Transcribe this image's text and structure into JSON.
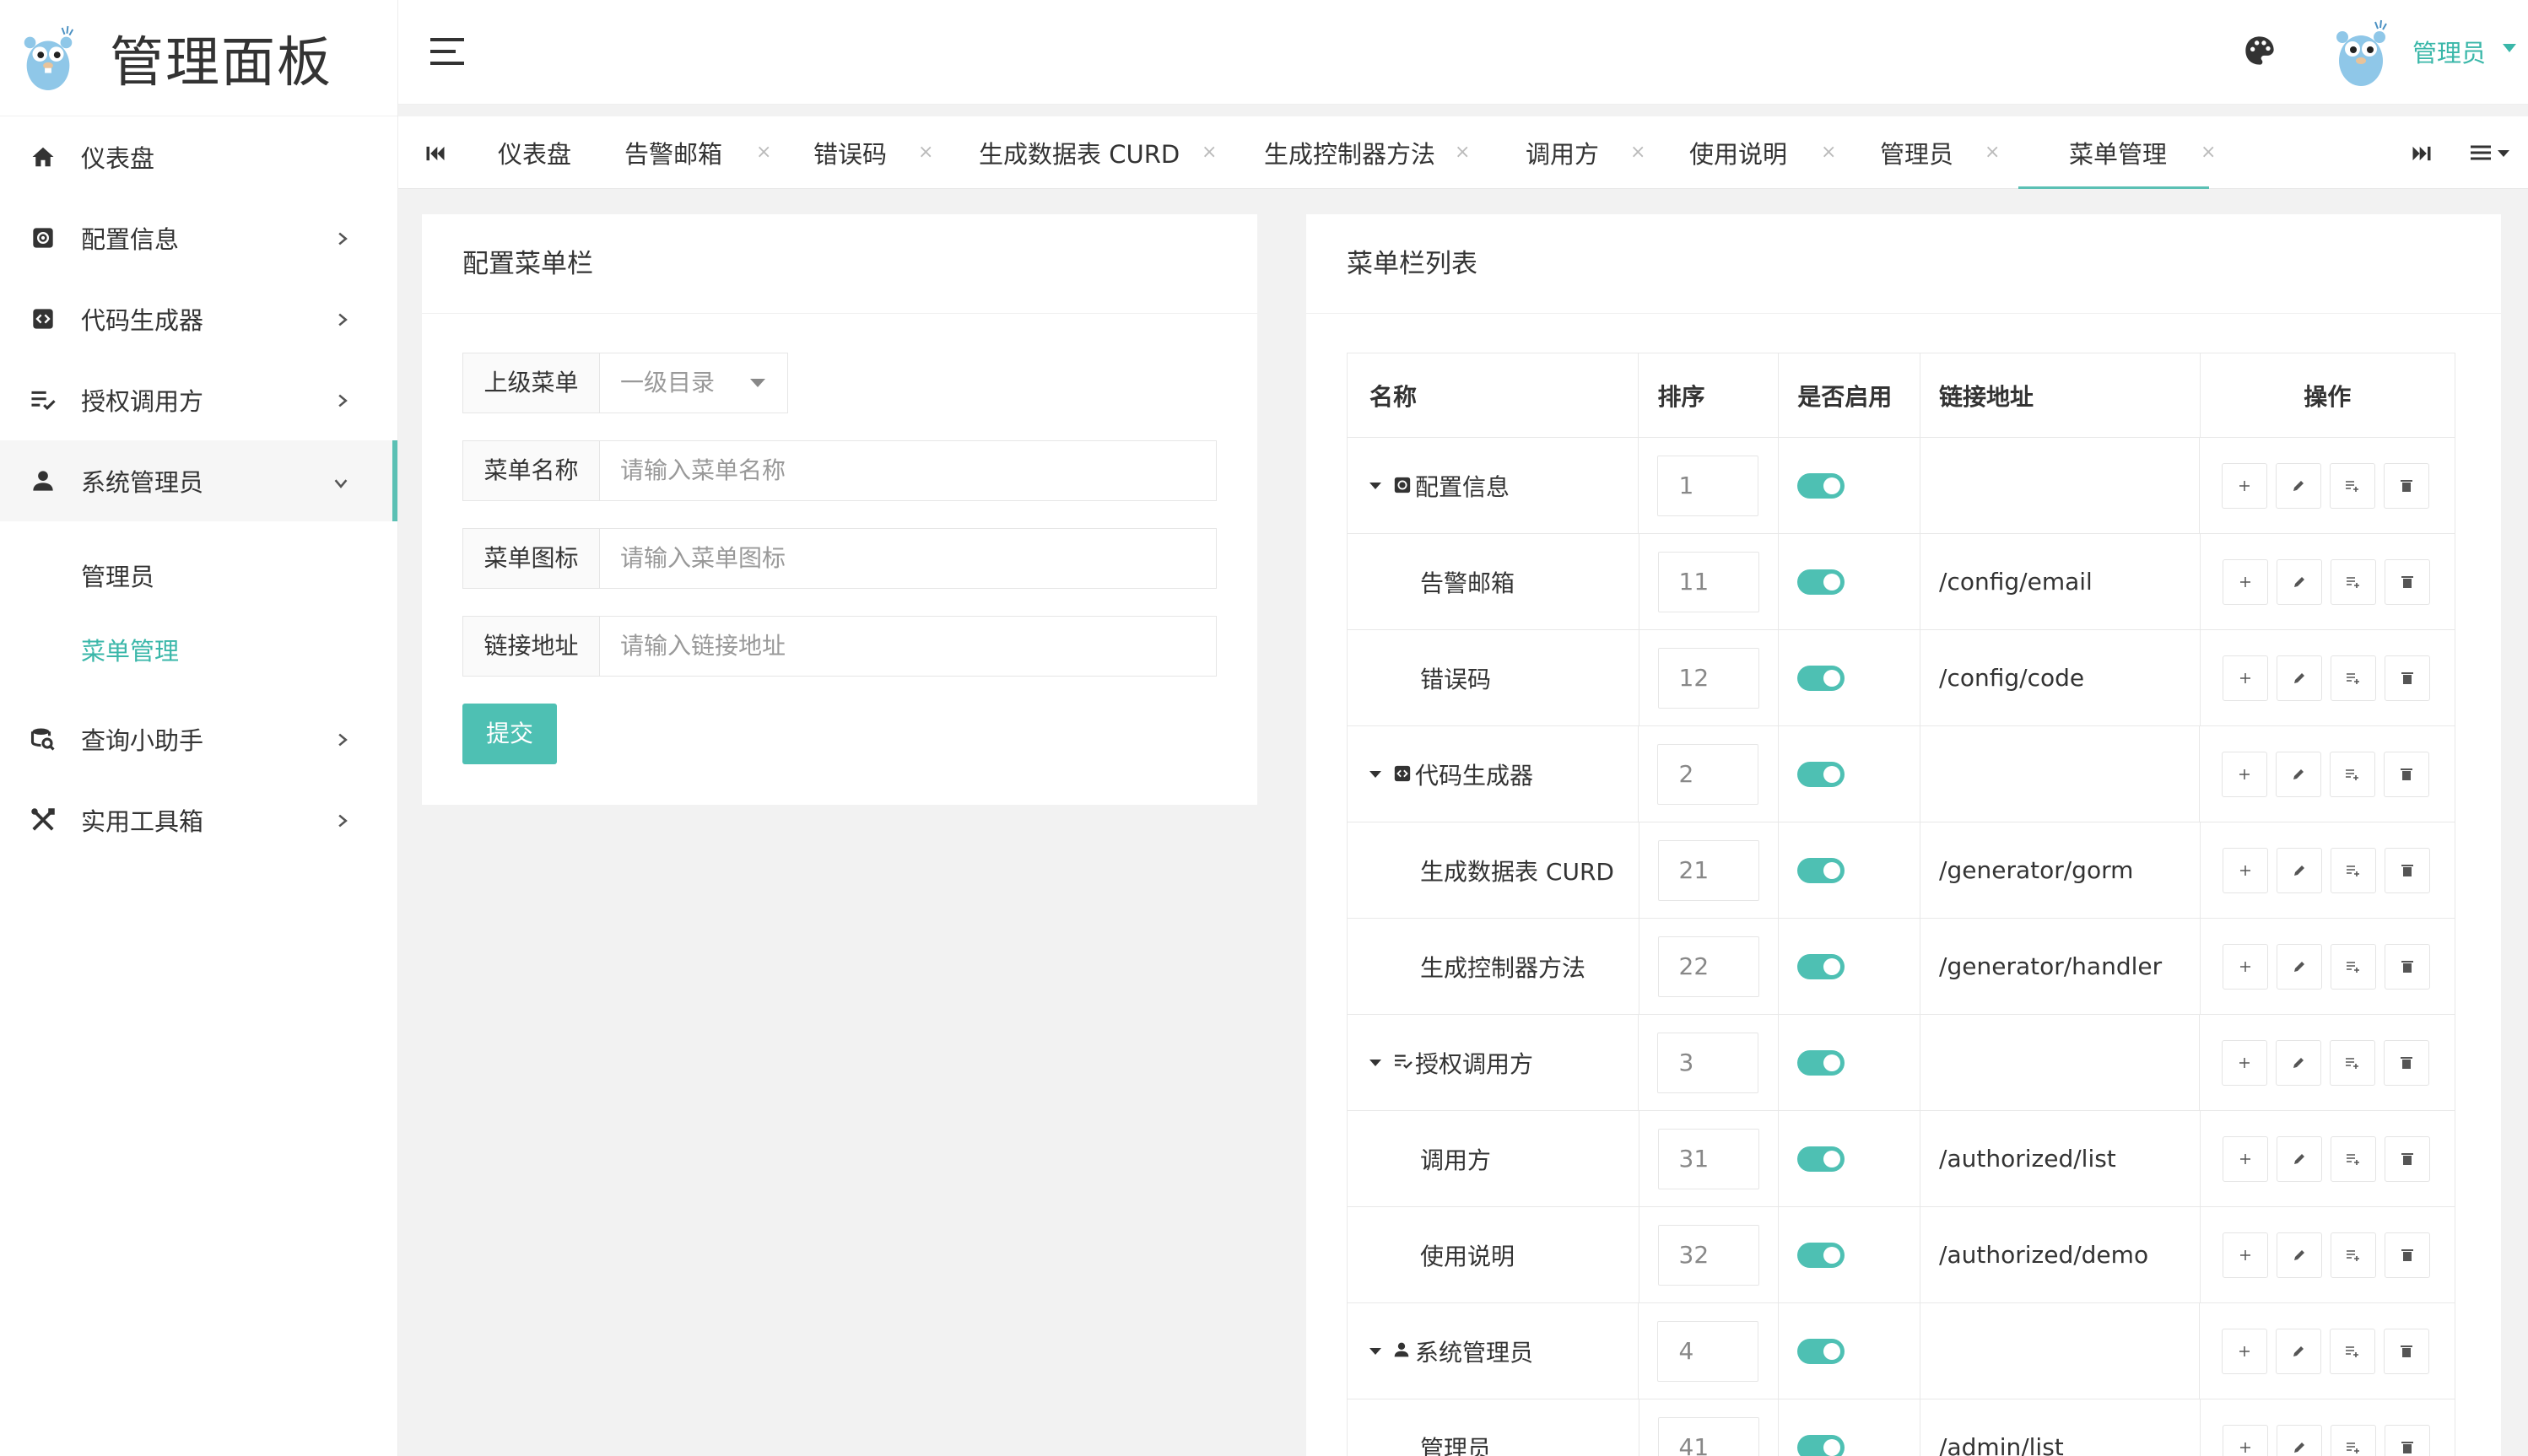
{
  "app": {
    "title": "管理面板"
  },
  "header": {
    "user_name": "管理员"
  },
  "sidebar": {
    "items": [
      {
        "label": "仪表盘"
      },
      {
        "label": "配置信息"
      },
      {
        "label": "代码生成器"
      },
      {
        "label": "授权调用方"
      },
      {
        "label": "系统管理员"
      },
      {
        "label": "查询小助手"
      },
      {
        "label": "实用工具箱"
      }
    ],
    "submenu": [
      {
        "label": "管理员"
      },
      {
        "label": "菜单管理"
      }
    ]
  },
  "tabs": [
    {
      "label": "仪表盘"
    },
    {
      "label": "告警邮箱"
    },
    {
      "label": "错误码"
    },
    {
      "label": "生成数据表 CURD"
    },
    {
      "label": "生成控制器方法"
    },
    {
      "label": "调用方"
    },
    {
      "label": "使用说明"
    },
    {
      "label": "管理员"
    },
    {
      "label": "菜单管理"
    }
  ],
  "form": {
    "title": "配置菜单栏",
    "parent_label": "上级菜单",
    "parent_value": "一级目录",
    "name_label": "菜单名称",
    "name_placeholder": "请输入菜单名称",
    "icon_label": "菜单图标",
    "icon_placeholder": "请输入菜单图标",
    "url_label": "链接地址",
    "url_placeholder": "请输入链接地址",
    "submit": "提交"
  },
  "list": {
    "title": "菜单栏列表",
    "headers": {
      "name": "名称",
      "sort": "排序",
      "enabled": "是否启用",
      "url": "链接地址",
      "ops": "操作"
    },
    "rows": [
      {
        "name": "配置信息",
        "sort": "1",
        "url": ""
      },
      {
        "name": "告警邮箱",
        "sort": "11",
        "url": "/config/email"
      },
      {
        "name": "错误码",
        "sort": "12",
        "url": "/config/code"
      },
      {
        "name": "代码生成器",
        "sort": "2",
        "url": ""
      },
      {
        "name": "生成数据表 CURD",
        "sort": "21",
        "url": "/generator/gorm"
      },
      {
        "name": "生成控制器方法",
        "sort": "22",
        "url": "/generator/handler"
      },
      {
        "name": "授权调用方",
        "sort": "3",
        "url": ""
      },
      {
        "name": "调用方",
        "sort": "31",
        "url": "/authorized/list"
      },
      {
        "name": "使用说明",
        "sort": "32",
        "url": "/authorized/demo"
      },
      {
        "name": "系统管理员",
        "sort": "4",
        "url": ""
      },
      {
        "name": "管理员",
        "sort": "41",
        "url": "/admin/list"
      }
    ]
  },
  "colors": {
    "accent": "#4ec0b3",
    "accent_text": "#3ab7a9"
  }
}
